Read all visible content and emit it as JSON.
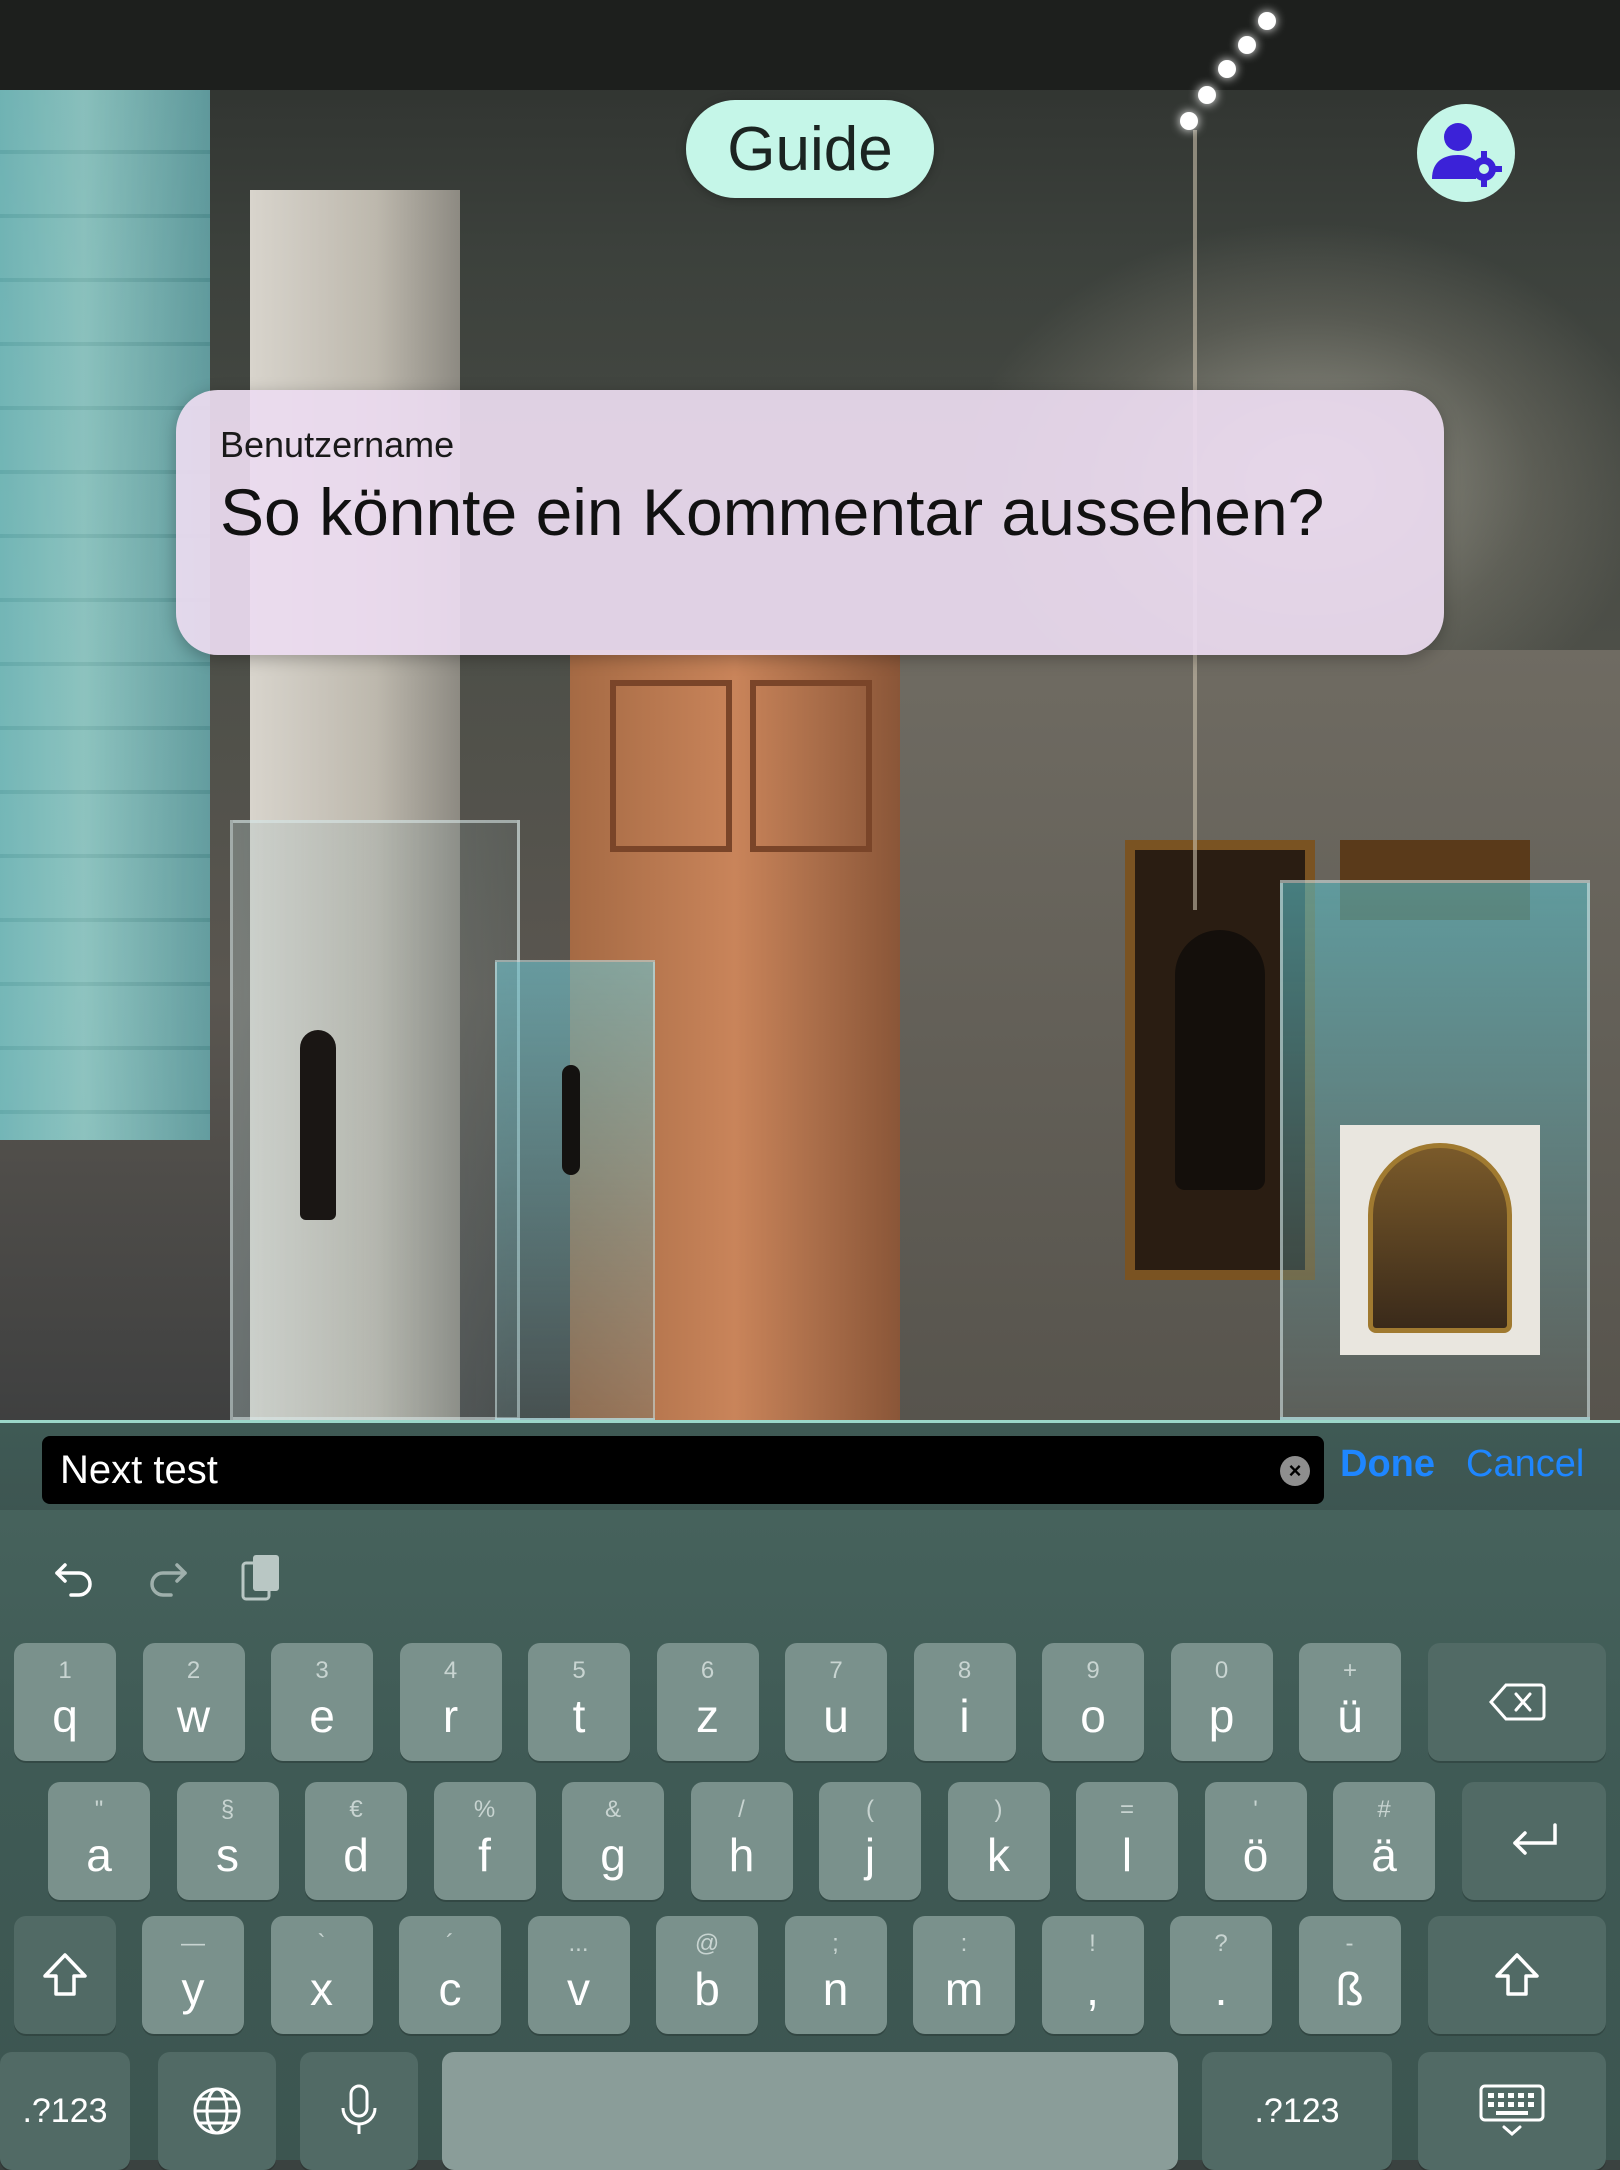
{
  "header": {
    "guide_label": "Guide",
    "profile_icon": "user-settings-icon"
  },
  "comment": {
    "username": "Benutzername",
    "text": "So könnte ein Kommentar aussehen?"
  },
  "input": {
    "value": "Next test",
    "done_label": "Done",
    "cancel_label": "Cancel"
  },
  "keyboard": {
    "row1": [
      {
        "sub": "1",
        "key": "q"
      },
      {
        "sub": "2",
        "key": "w"
      },
      {
        "sub": "3",
        "key": "e"
      },
      {
        "sub": "4",
        "key": "r"
      },
      {
        "sub": "5",
        "key": "t"
      },
      {
        "sub": "6",
        "key": "z"
      },
      {
        "sub": "7",
        "key": "u"
      },
      {
        "sub": "8",
        "key": "i"
      },
      {
        "sub": "9",
        "key": "o"
      },
      {
        "sub": "0",
        "key": "p"
      },
      {
        "sub": "+",
        "key": "ü"
      }
    ],
    "row2": [
      {
        "sub": "\"",
        "key": "a"
      },
      {
        "sub": "§",
        "key": "s"
      },
      {
        "sub": "€",
        "key": "d"
      },
      {
        "sub": "%",
        "key": "f"
      },
      {
        "sub": "&",
        "key": "g"
      },
      {
        "sub": "/",
        "key": "h"
      },
      {
        "sub": "(",
        "key": "j"
      },
      {
        "sub": ")",
        "key": "k"
      },
      {
        "sub": "=",
        "key": "l"
      },
      {
        "sub": "'",
        "key": "ö"
      },
      {
        "sub": "#",
        "key": "ä"
      }
    ],
    "row3": [
      {
        "sub": "—",
        "key": "y"
      },
      {
        "sub": "`",
        "key": "x"
      },
      {
        "sub": "´",
        "key": "c"
      },
      {
        "sub": "...",
        "key": "v"
      },
      {
        "sub": "@",
        "key": "b"
      },
      {
        "sub": ";",
        "key": "n"
      },
      {
        "sub": ":",
        "key": "m"
      },
      {
        "sub": "!",
        "key": ","
      },
      {
        "sub": "?",
        "key": "."
      },
      {
        "sub": "-",
        "key": "ß"
      }
    ],
    "numbers_label": ".?123",
    "numbers_label_right": ".?123"
  }
}
